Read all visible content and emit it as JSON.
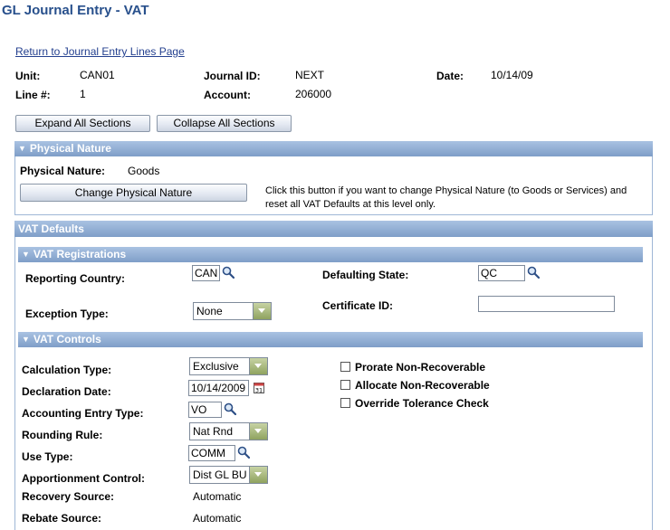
{
  "page": {
    "title": "GL Journal Entry - VAT",
    "return_link": "Return to Journal Entry Lines Page"
  },
  "header": {
    "unit_label": "Unit:",
    "unit_value": "CAN01",
    "journal_label": "Journal ID:",
    "journal_value": "NEXT",
    "date_label": "Date:",
    "date_value": "10/14/09",
    "line_label": "Line #:",
    "line_value": "1",
    "account_label": "Account:",
    "account_value": "206000"
  },
  "buttons": {
    "expand": "Expand All Sections",
    "collapse": "Collapse All Sections",
    "change_nature": "Change Physical Nature"
  },
  "physical_nature": {
    "header": "Physical Nature",
    "label": "Physical Nature:",
    "value": "Goods",
    "help_line1": "Click this button if you want to change Physical Nature (to Goods or Services) and",
    "help_line2": "reset all VAT Defaults at this level only."
  },
  "vat_defaults": {
    "header": "VAT Defaults"
  },
  "registrations": {
    "header": "VAT Registrations",
    "reporting_country_label": "Reporting Country:",
    "reporting_country_value": "CAN",
    "defaulting_state_label": "Defaulting State:",
    "defaulting_state_value": "QC",
    "exception_type_label": "Exception Type:",
    "exception_type_value": "None",
    "certificate_label": "Certificate ID:",
    "certificate_value": ""
  },
  "controls": {
    "header": "VAT Controls",
    "calc_type_label": "Calculation Type:",
    "calc_type_value": "Exclusive",
    "decl_date_label": "Declaration Date:",
    "decl_date_value": "10/14/2009",
    "acct_entry_label": "Accounting Entry Type:",
    "acct_entry_value": "VO",
    "rounding_label": "Rounding Rule:",
    "rounding_value": "Nat Rnd",
    "use_type_label": "Use Type:",
    "use_type_value": "COMM",
    "apportion_label": "Apportionment Control:",
    "apportion_value": "Dist GL BU",
    "recovery_label": "Recovery Source:",
    "recovery_value": "Automatic",
    "rebate_label": "Rebate Source:",
    "rebate_value": "Automatic",
    "prorate_label": "Prorate Non-Recoverable",
    "allocate_label": "Allocate Non-Recoverable",
    "override_label": "Override Tolerance Check"
  },
  "colors": {
    "title": "#28508c",
    "section_header": "#8fabd3",
    "link": "#24408f"
  }
}
